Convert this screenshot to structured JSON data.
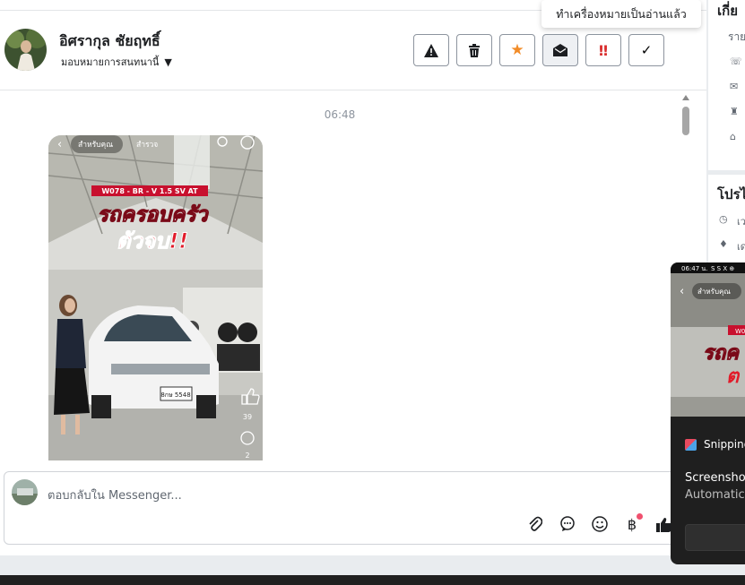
{
  "header": {
    "contact_name": "อิศรากุล ชัยฤทธิ์",
    "assign_label": "มอบหมายการสนทนานี้",
    "tooltip": "ทำเครื่องหมายเป็นอ่านแล้ว",
    "actions": [
      {
        "icon": "warning-icon",
        "glyph": "⚠"
      },
      {
        "icon": "trash-icon",
        "glyph": "🗑"
      },
      {
        "icon": "star-icon",
        "glyph": "★",
        "color": "#f28c28"
      },
      {
        "icon": "envelope-open-icon",
        "glyph": "✉"
      },
      {
        "icon": "important-icon",
        "glyph": "‼",
        "color": "#d92c2c"
      },
      {
        "icon": "check-icon",
        "glyph": "✓"
      }
    ]
  },
  "conversation": {
    "timestamp": "06:48",
    "video": {
      "tab_for_you": "สำหรับคุณ",
      "tab_explore": "สำรวจ",
      "banner": "W078 - BR - V 1.5 SV AT",
      "headline_1": "รถครอบครัว",
      "headline_2": "ตัวจบ!!",
      "plate": "8กษ 5548",
      "like_count": "39",
      "comment_count": "2"
    }
  },
  "composer": {
    "placeholder": "ตอบกลับใน Messenger...",
    "tools": [
      "paperclip-icon",
      "chat-bubble-icon",
      "smiley-icon",
      "baht-icon",
      "thumbs-up-icon"
    ]
  },
  "side_panel": {
    "heading": "เกี่ย",
    "subheading": "ราย",
    "section_heading": "โปรไ",
    "row_1": "เว",
    "row_2": "เด"
  },
  "notification": {
    "status_time": "06:47 น.",
    "status_icons": "S S X ⊕",
    "video_tab": "สำหรับคุณ",
    "video_banner": "W0",
    "video_text_1": "รถค",
    "video_text_2": "ต",
    "app_name": "Snipping",
    "title": "Screenshot",
    "body": "Automatica"
  },
  "colors": {
    "accent_star": "#f28c28",
    "accent_important": "#d92c2c",
    "badge_dot": "#f0506e"
  }
}
